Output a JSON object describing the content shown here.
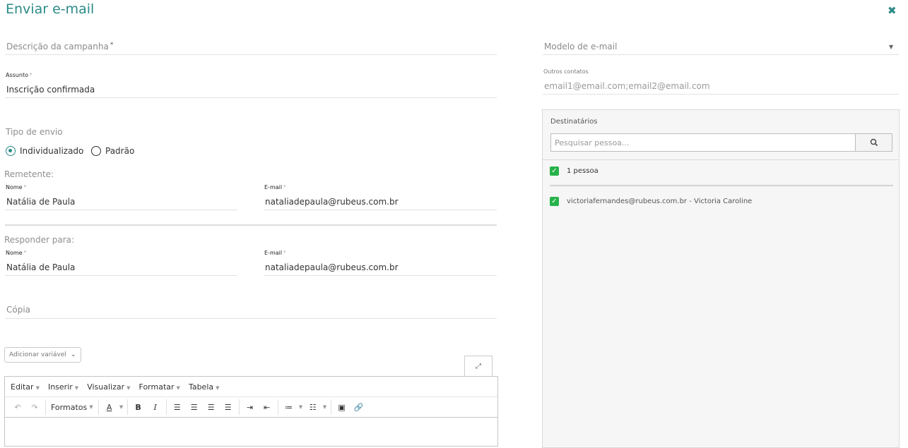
{
  "header": {
    "title": "Enviar e-mail"
  },
  "form": {
    "campaign_description_placeholder": "Descrição da campanha",
    "required_mark": "*",
    "subject_label": "Assunto",
    "subject_value": "Inscrição confirmada",
    "send_type_label": "Tipo de envio",
    "send_type_options": [
      "Individualizado",
      "Padrão"
    ],
    "sender_label": "Remetente:",
    "sender_name_label": "Nome",
    "sender_name_value": "Natália de Paula",
    "sender_email_label": "E-mail",
    "sender_email_value": "nataliadepaula@rubeus.com.br",
    "reply_label": "Responder para:",
    "reply_name_label": "Nome",
    "reply_name_value": "Natália de Paula",
    "reply_email_label": "E-mail",
    "reply_email_value": "nataliadepaula@rubeus.com.br",
    "copy_placeholder": "Cópia"
  },
  "right": {
    "template_placeholder": "Modelo de e-mail",
    "other_contacts_label": "Outros contatos",
    "other_contacts_placeholder": "email1@email.com;email2@email.com",
    "recipients_label": "Destinatários",
    "search_placeholder": "Pesquisar pessoa...",
    "count_label": "1 pessoa",
    "recipients": [
      "victoriafernandes@rubeus.com.br - Victoria Caroline"
    ]
  },
  "editor": {
    "add_variable_label": "Adicionar variável",
    "menus": [
      "Editar",
      "Inserir",
      "Visualizar",
      "Formatar",
      "Tabela"
    ],
    "formats_label": "Formatos"
  },
  "colors": {
    "accent": "#2a8b87",
    "check": "#27b24a"
  }
}
